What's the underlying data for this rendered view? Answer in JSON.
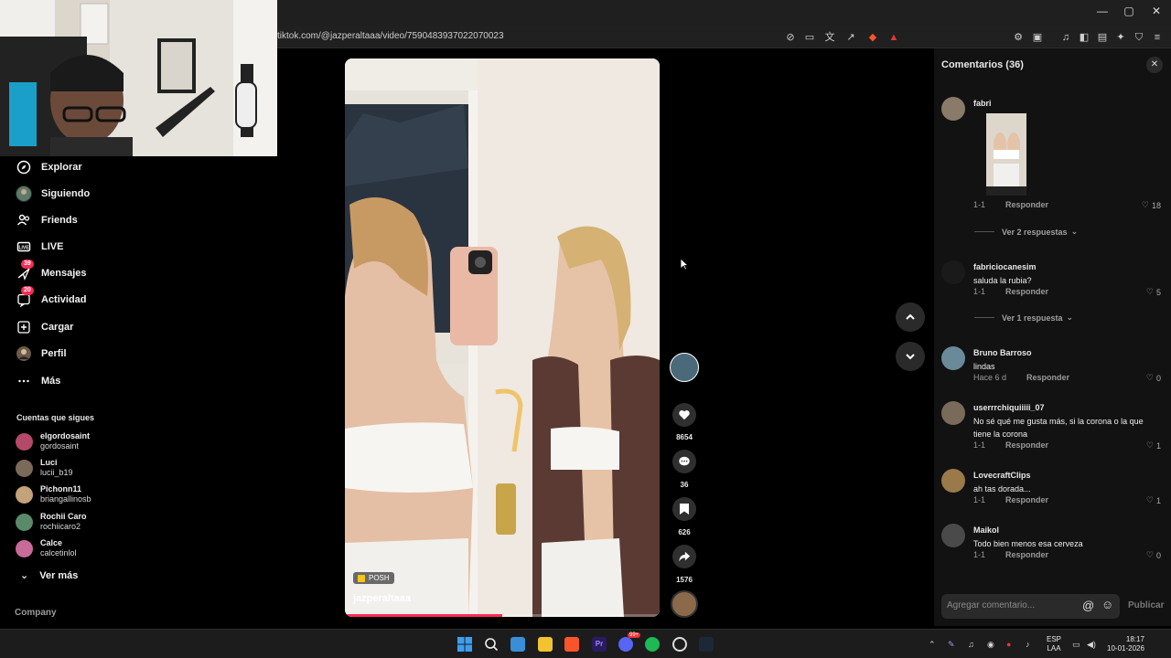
{
  "browser": {
    "url": "tiktok.com/@jazperaltaaa/video/7590483937022070023",
    "window_controls": [
      "—",
      "▢",
      "✕"
    ]
  },
  "sidebar": {
    "items": [
      {
        "label": "Explorar",
        "icon": "compass-icon"
      },
      {
        "label": "Siguiendo",
        "icon": "following-avatar-icon"
      },
      {
        "label": "Friends",
        "icon": "friends-icon"
      },
      {
        "label": "LIVE",
        "icon": "live-icon"
      },
      {
        "label": "Mensajes",
        "icon": "messages-icon",
        "badge": "39"
      },
      {
        "label": "Actividad",
        "icon": "activity-icon",
        "badge": "20"
      },
      {
        "label": "Cargar",
        "icon": "upload-icon"
      },
      {
        "label": "Perfil",
        "icon": "profile-icon"
      },
      {
        "label": "Más",
        "icon": "more-icon"
      }
    ],
    "following_title": "Cuentas que sigues",
    "following": [
      {
        "name": "elgordosaint",
        "handle": "gordosaint",
        "color": "#b44a6a"
      },
      {
        "name": "Luci",
        "handle": "lucii_b19",
        "color": "#7a6a5a"
      },
      {
        "name": "Pichonn11",
        "handle": "briangallinosb",
        "color": "#c4a37a"
      },
      {
        "name": "Rochii Caro",
        "handle": "rochiicaro2",
        "color": "#5a8a6a"
      },
      {
        "name": "Calce",
        "handle": "calcetinlol",
        "color": "#c86a9a"
      }
    ],
    "see_more": "Ver más",
    "company": "Company"
  },
  "video": {
    "tag": "POSH",
    "author": "jazperaltaaa",
    "progress": 0.5
  },
  "actions": {
    "likes": "8654",
    "comments": "36",
    "saves": "626",
    "shares": "1576"
  },
  "comments_panel": {
    "title": "Comentarios (36)",
    "input_placeholder": "Agregar comentario...",
    "publish": "Publicar",
    "reply_label": "Responder",
    "items": [
      {
        "user": "fabri",
        "text": "",
        "meta": "1-1",
        "likes": "18",
        "view_replies": "Ver 2 respuestas",
        "color": "#8a7a6a"
      },
      {
        "user": "fabriciocanesim",
        "text": "saluda la rubia?",
        "meta": "1-1",
        "likes": "5",
        "view_replies": "Ver 1 respuesta",
        "color": "#1a1a1a"
      },
      {
        "user": "Bruno Barroso",
        "text": "lindas",
        "meta": "Hace 6 d",
        "likes": "0",
        "color": "#6a8a9a"
      },
      {
        "user": "userrrchiquiiiii_07",
        "text": "No sé qué me gusta más, si la corona o la que tiene la corona",
        "meta": "1-1",
        "likes": "1",
        "color": "#7a6a5a"
      },
      {
        "user": "LovecraftClips",
        "text": "ah tas dorada...",
        "meta": "1-1",
        "likes": "1",
        "color": "#9a7a4a"
      },
      {
        "user": "Maikol",
        "text": "Todo bien menos esa cerveza",
        "meta": "1-1",
        "likes": "0",
        "color": "#4a4a4a"
      }
    ]
  },
  "taskbar": {
    "lang_1": "ESP",
    "lang_2": "LAA",
    "time": "18:17",
    "date": "10-01-2026",
    "discord_badge": "99+"
  }
}
